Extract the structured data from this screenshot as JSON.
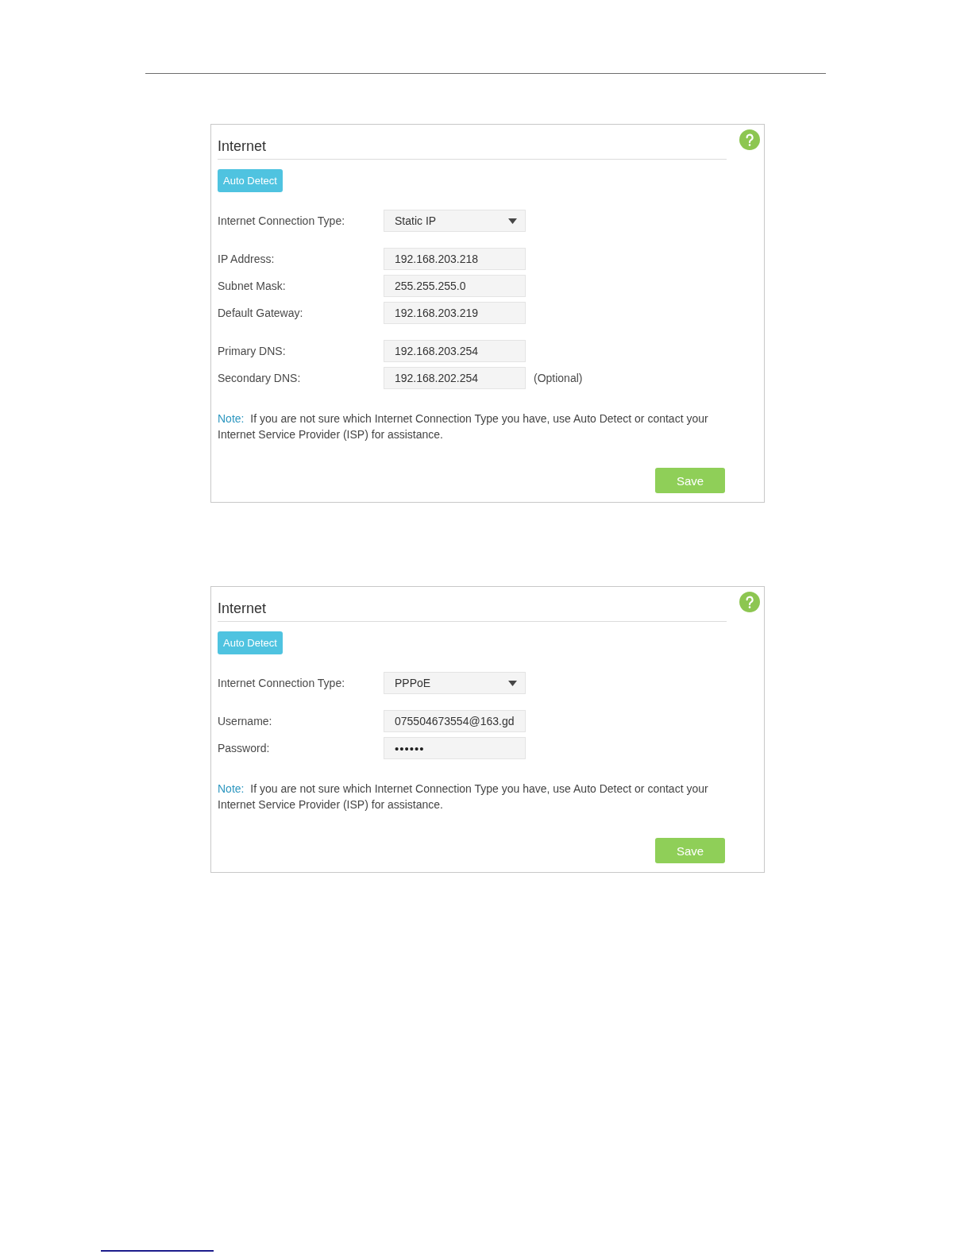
{
  "panels": [
    {
      "title": "Internet",
      "auto_detect_button": "Auto Detect",
      "connection_type": {
        "label": "Internet Connection Type:",
        "value": "Static IP"
      },
      "field_groups": [
        {
          "fields": [
            {
              "kind": "text",
              "label": "IP Address:",
              "value": "192.168.203.218"
            },
            {
              "kind": "text",
              "label": "Subnet Mask:",
              "value": "255.255.255.0"
            },
            {
              "kind": "text",
              "label": "Default Gateway:",
              "value": "192.168.203.219"
            }
          ]
        },
        {
          "fields": [
            {
              "kind": "text",
              "label": "Primary DNS:",
              "value": "192.168.203.254"
            },
            {
              "kind": "text",
              "label": "Secondary DNS:",
              "value": "192.168.202.254",
              "hint": "(Optional)"
            }
          ]
        }
      ],
      "note": {
        "label": "Note:",
        "text": "If you are not sure which Internet Connection Type you have, use Auto Detect or contact your Internet Service Provider (ISP) for assistance."
      },
      "save_button": "Save"
    },
    {
      "title": "Internet",
      "auto_detect_button": "Auto Detect",
      "connection_type": {
        "label": "Internet Connection Type:",
        "value": "PPPoE"
      },
      "field_groups": [
        {
          "fields": [
            {
              "kind": "text",
              "label": "Username:",
              "value": "075504673554@163.gd"
            },
            {
              "kind": "password",
              "label": "Password:",
              "value": "••••••"
            }
          ]
        }
      ],
      "note": {
        "label": "Note:",
        "text": "If you are not sure which Internet Connection Type you have, use Auto Detect or contact your Internet Service Provider (ISP) for assistance."
      },
      "save_button": "Save"
    }
  ]
}
